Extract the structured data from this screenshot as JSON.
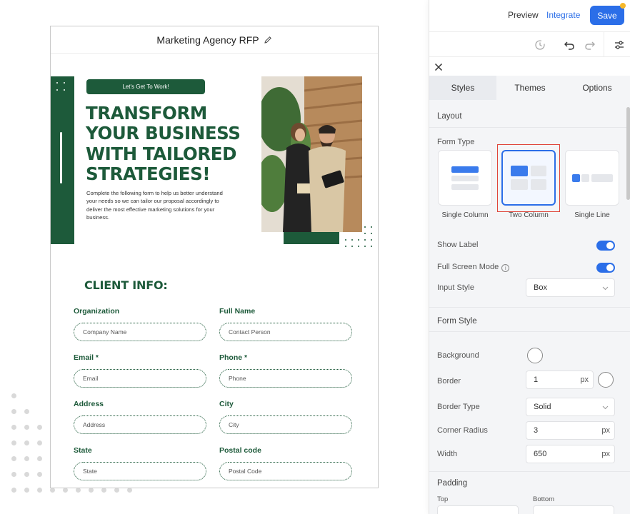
{
  "form_preview": {
    "title": "Marketing Agency RFP",
    "hero": {
      "pill": "Let's Get To Work!",
      "headline_lines": [
        "TRANSFORM",
        "YOUR BUSINESS",
        "WITH TAILORED",
        "STRATEGIES!"
      ],
      "description": "Complete the following form to help us better understand your needs so we can tailor our proposal accordingly to deliver the most effective marketing solutions for your business."
    },
    "section_title": "CLIENT INFO:",
    "fields": [
      {
        "label": "Organization",
        "placeholder": "Company Name"
      },
      {
        "label": "Full Name",
        "placeholder": "Contact Person"
      },
      {
        "label": "Email *",
        "placeholder": "Email"
      },
      {
        "label": "Phone *",
        "placeholder": "Phone"
      },
      {
        "label": "Address",
        "placeholder": "Address"
      },
      {
        "label": "City",
        "placeholder": "City"
      },
      {
        "label": "State",
        "placeholder": "State"
      },
      {
        "label": "Postal code",
        "placeholder": "Postal Code"
      }
    ],
    "brand_color": "#1d5a3a"
  },
  "panel": {
    "topbar": {
      "preview": "Preview",
      "integrate": "Integrate",
      "save": "Save"
    },
    "toolbar_icons": [
      "history-icon",
      "undo-icon",
      "redo-icon",
      "settings-sliders-icon"
    ],
    "tabs": [
      {
        "label": "Styles",
        "active": true
      },
      {
        "label": "Themes",
        "active": false
      },
      {
        "label": "Options",
        "active": false
      }
    ],
    "layout": {
      "heading": "Layout",
      "form_type_label": "Form Type",
      "form_types": [
        {
          "label": "Single Column",
          "selected": false
        },
        {
          "label": "Two Column",
          "selected": true
        },
        {
          "label": "Single Line",
          "selected": false
        }
      ],
      "show_label": {
        "label": "Show Label",
        "on": true
      },
      "full_screen_mode": {
        "label": "Full Screen Mode",
        "on": true
      },
      "input_style": {
        "label": "Input Style",
        "value": "Box"
      }
    },
    "form_style": {
      "heading": "Form Style",
      "background": {
        "label": "Background"
      },
      "border": {
        "label": "Border",
        "value": "1",
        "unit": "px"
      },
      "border_type": {
        "label": "Border Type",
        "value": "Solid"
      },
      "corner_radius": {
        "label": "Corner Radius",
        "value": "3",
        "unit": "px"
      },
      "width": {
        "label": "Width",
        "value": "650",
        "unit": "px"
      }
    },
    "padding": {
      "heading": "Padding",
      "top_label": "Top",
      "bottom_label": "Bottom"
    },
    "accent_color": "#2b6ee8"
  }
}
